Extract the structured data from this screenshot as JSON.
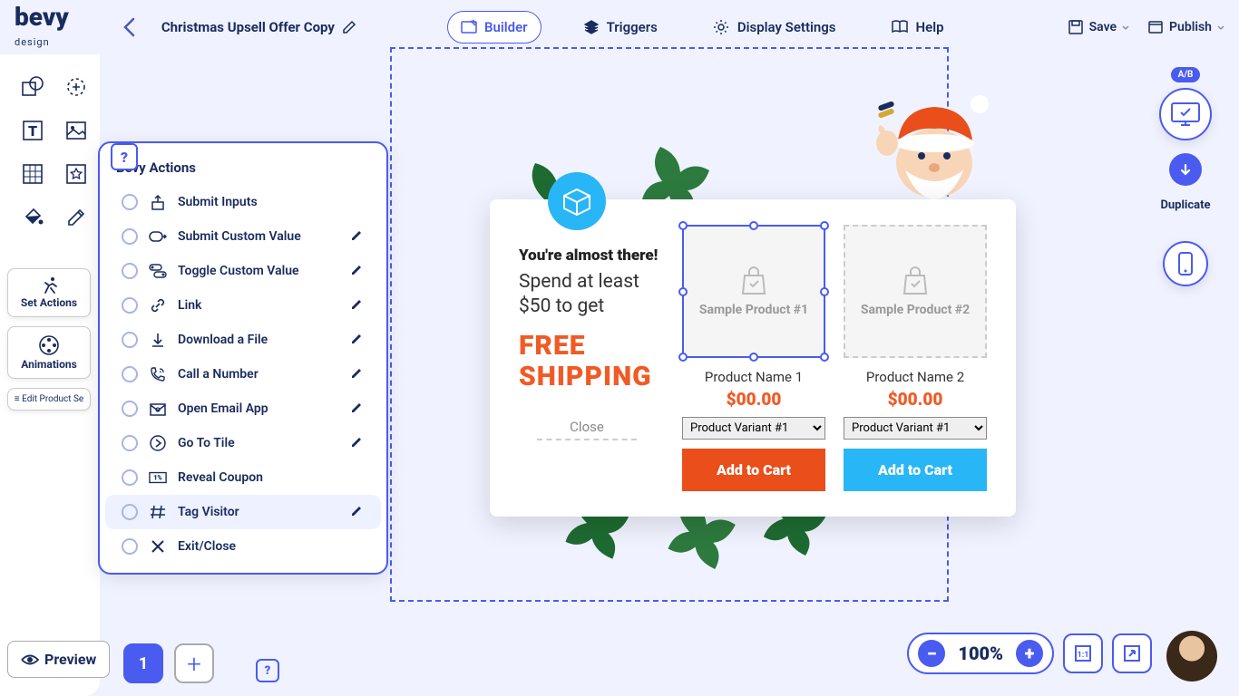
{
  "brand": {
    "name": "bevy",
    "tagline": "design"
  },
  "header": {
    "title": "Christmas Upsell Offer Copy",
    "tabs": {
      "builder": "Builder",
      "triggers": "Triggers",
      "display": "Display Settings",
      "help": "Help"
    },
    "save": "Save",
    "publish": "Publish"
  },
  "side": {
    "set_actions": "Set Actions",
    "animations": "Animations",
    "edit_product": "≡ Edit Product Se"
  },
  "panel": {
    "title": "Bevy Actions",
    "items": [
      "Submit Inputs",
      "Submit Custom Value",
      "Toggle Custom Value",
      "Link",
      "Download a File",
      "Call a Number",
      "Open Email App",
      "Go To Tile",
      "Reveal Coupon",
      "Tag Visitor",
      "Exit/Close"
    ]
  },
  "popup": {
    "h1": "You're almost there!",
    "h2": "Spend at least $50 to get",
    "free1": "FREE",
    "free2": "SHIPPING",
    "close": "Close",
    "products": [
      {
        "placeholder": "Sample Product #1",
        "name": "Product Name 1",
        "price": "$00.00",
        "variant": "Product Variant #1",
        "cta": "Add to Cart"
      },
      {
        "placeholder": "Sample Product #2",
        "name": "Product Name 2",
        "price": "$00.00",
        "variant": "Product Variant #1",
        "cta": "Add to Cart"
      }
    ]
  },
  "right": {
    "ab": "A/B",
    "duplicate": "Duplicate"
  },
  "bottom": {
    "preview": "Preview",
    "page": "1",
    "zoom": "100%"
  }
}
